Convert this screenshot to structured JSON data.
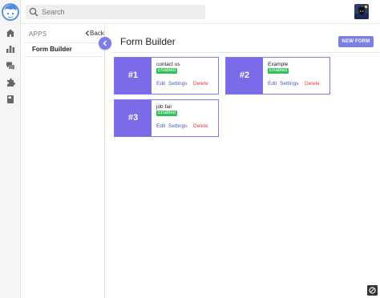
{
  "search": {
    "placeholder": "Search",
    "value": ""
  },
  "apps_panel": {
    "title": "APPS",
    "back_label": "Back",
    "items": [
      {
        "label": "Form Builder"
      }
    ]
  },
  "main": {
    "title": "Form Builder",
    "new_form_label": "NEW FORM"
  },
  "forms": [
    {
      "number": "#1",
      "name": "contact us",
      "status": "Enabled",
      "edit": "Edit",
      "settings": "Settings",
      "delete": "Delete"
    },
    {
      "number": "#2",
      "name": "Example",
      "status": "Enabled",
      "edit": "Edit",
      "settings": "Settings",
      "delete": "Delete"
    },
    {
      "number": "#3",
      "name": "job fair",
      "status": "Enabled",
      "edit": "Edit",
      "settings": "Settings",
      "delete": "Delete"
    }
  ],
  "colors": {
    "accent": "#7b7fe8",
    "card_block": "#7b6be8",
    "enabled_badge": "#33c05a",
    "delete_link": "#e04040",
    "action_link": "#4b55c8"
  },
  "icons": [
    "logo-icon",
    "home-icon",
    "bar-chart-icon",
    "chat-icon",
    "puzzle-icon",
    "book-icon",
    "search-icon",
    "chevron-left-icon",
    "user-avatar",
    "settings-badge-icon"
  ]
}
